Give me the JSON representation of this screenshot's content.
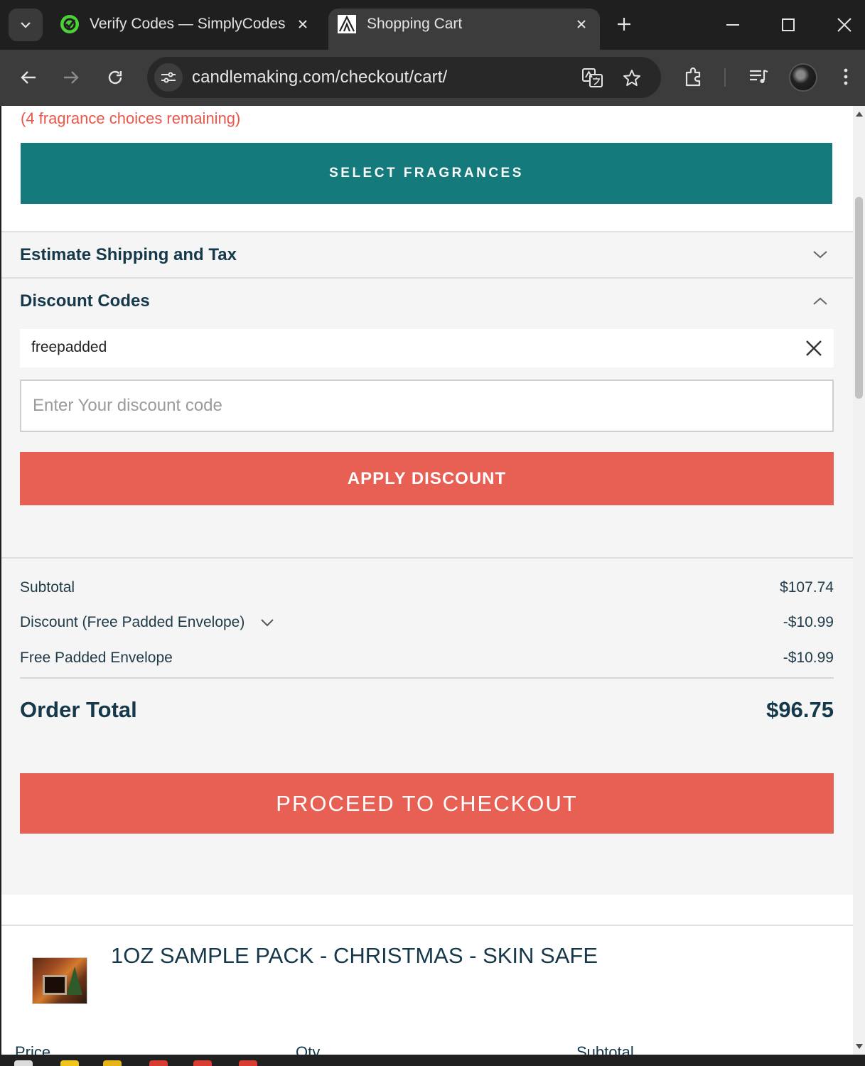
{
  "browser": {
    "tabs": [
      {
        "title": "Verify Codes — SimplyCodes",
        "active": false,
        "favicon": "simplycodes-logo-icon"
      },
      {
        "title": "Shopping Cart",
        "active": true,
        "favicon": "candlemaking-logo-icon"
      }
    ],
    "url": "candlemaking.com/checkout/cart/"
  },
  "page": {
    "fragrance_notice": "(4 fragrance choices remaining)",
    "select_fragrances_label": "SELECT FRAGRANCES",
    "estimate_shipping_label": "Estimate Shipping and Tax",
    "discount_codes_label": "Discount Codes",
    "applied_code": "freepadded",
    "discount_input_placeholder": "Enter Your discount code",
    "apply_discount_label": "APPLY DISCOUNT",
    "summary": {
      "subtotal_label": "Subtotal",
      "subtotal_value": "$107.74",
      "discount_label": "Discount (Free Padded Envelope)",
      "discount_value": "-$10.99",
      "envelope_label": "Free Padded Envelope",
      "envelope_value": "-$10.99",
      "order_total_label": "Order Total",
      "order_total_value": "$96.75"
    },
    "checkout_label": "PROCEED TO CHECKOUT",
    "item": {
      "title": "1OZ SAMPLE PACK - CHRISTMAS - SKIN SAFE",
      "col_price": "Price",
      "col_qty": "Qty",
      "col_subtotal": "Subtotal"
    }
  },
  "colors": {
    "teal_button": "#147a7b",
    "coral_button": "#e85f54",
    "notice_red": "#e8574b",
    "heading_navy": "#15394a"
  }
}
